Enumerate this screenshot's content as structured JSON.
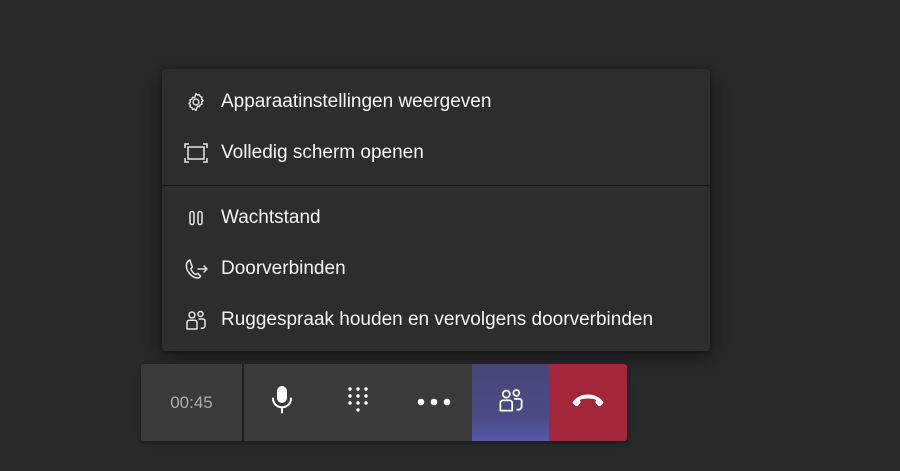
{
  "menu": {
    "items": [
      {
        "label": "Apparaatinstellingen weergeven",
        "icon": "gear-icon"
      },
      {
        "label": "Volledig scherm openen",
        "icon": "fullscreen-icon"
      },
      {
        "label": "Wachtstand",
        "icon": "pause-icon"
      },
      {
        "label": "Doorverbinden",
        "icon": "transfer-call-icon"
      },
      {
        "label": "Ruggespraak houden en vervolgens doorverbinden",
        "icon": "consult-transfer-icon"
      }
    ]
  },
  "toolbar": {
    "timer": "00:45",
    "buttons": [
      {
        "name": "microphone",
        "icon": "microphone-icon"
      },
      {
        "name": "dialpad",
        "icon": "dialpad-icon"
      },
      {
        "name": "more",
        "icon": "more-options-icon"
      },
      {
        "name": "consult",
        "icon": "consult-transfer-icon",
        "active": true
      },
      {
        "name": "hang-up",
        "icon": "hang-up-icon"
      }
    ]
  },
  "colors": {
    "background": "#292929",
    "menu_background": "#2d2d2d",
    "toolbar_background": "#3a3a3a",
    "active_button": "#4a4b86",
    "hang_up": "#a4263b",
    "timer_text": "#adadad"
  }
}
